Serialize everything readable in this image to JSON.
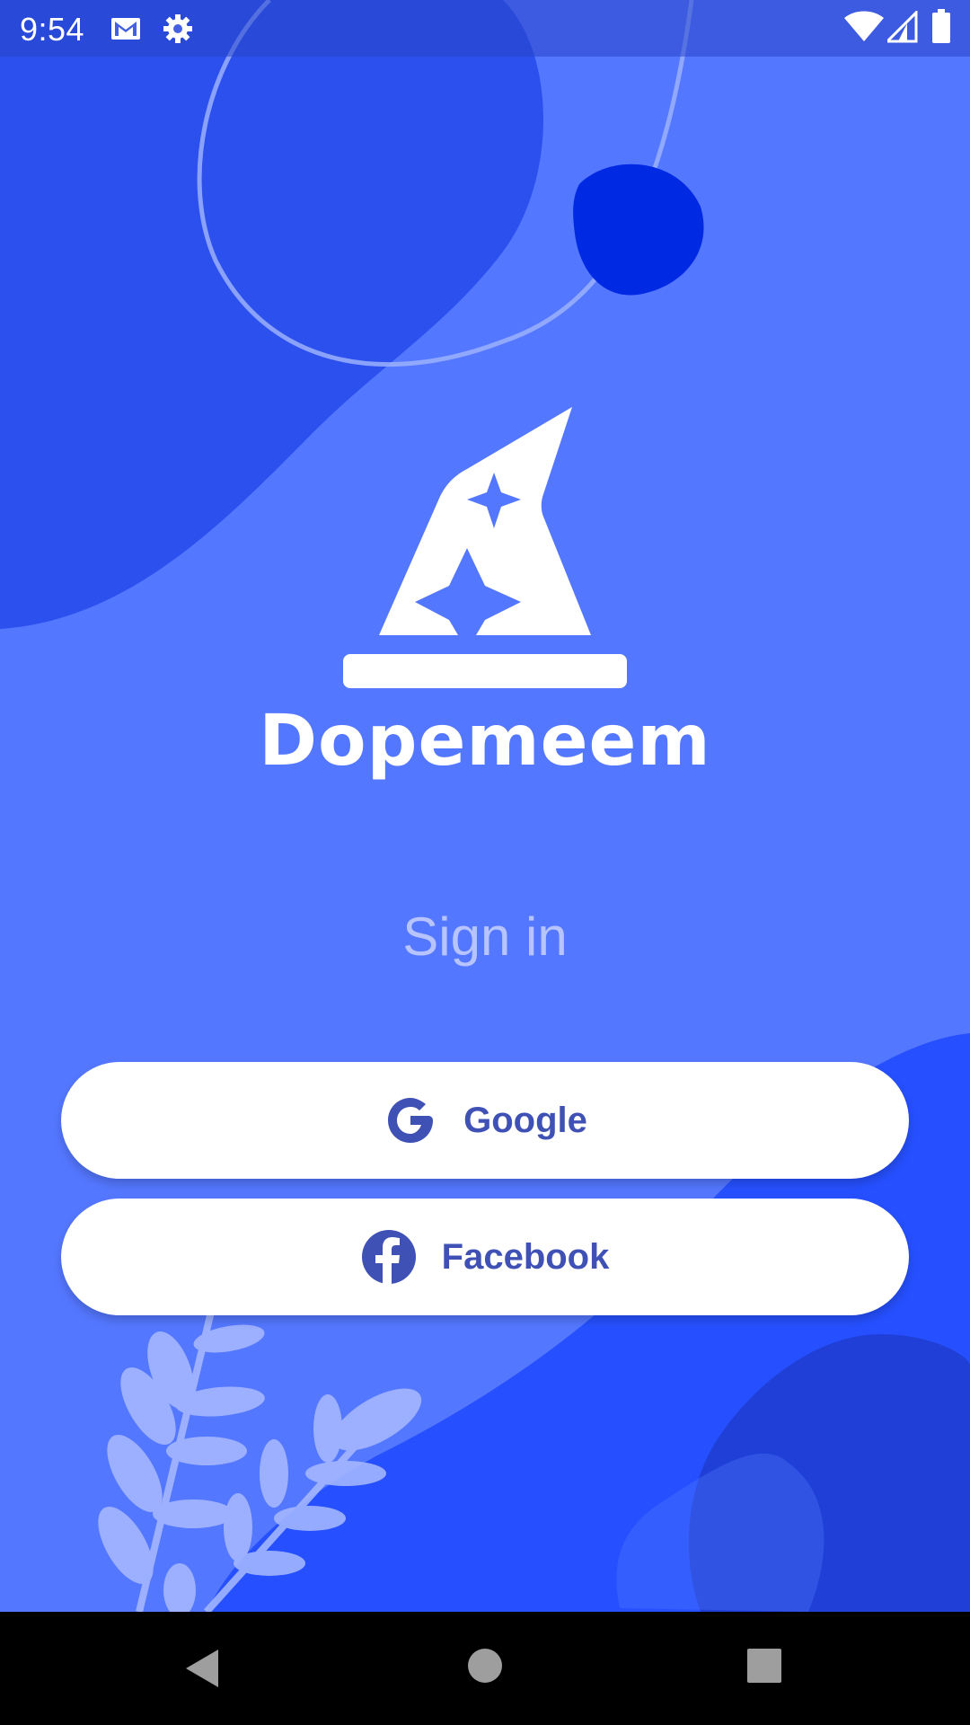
{
  "status_bar": {
    "time": "9:54",
    "left_icons": [
      "gmail-icon",
      "settings-icon"
    ],
    "right_icons": [
      "wifi-icon",
      "cellular-signal-icon",
      "battery-icon"
    ]
  },
  "brand": {
    "name": "Dopemeem",
    "logo": "wizard-hat-logo"
  },
  "signin": {
    "heading": "Sign in",
    "google_label": "Google",
    "facebook_label": "Facebook"
  },
  "nav_bar": {
    "buttons": [
      "back-icon",
      "home-icon",
      "recents-icon"
    ]
  },
  "colors": {
    "background": "#5477FF",
    "dark_blob": "#2B50EE",
    "deep_blue_dot": "#0029E3",
    "button_text": "#3F51B5",
    "signin_text": "#B7C4FF"
  }
}
